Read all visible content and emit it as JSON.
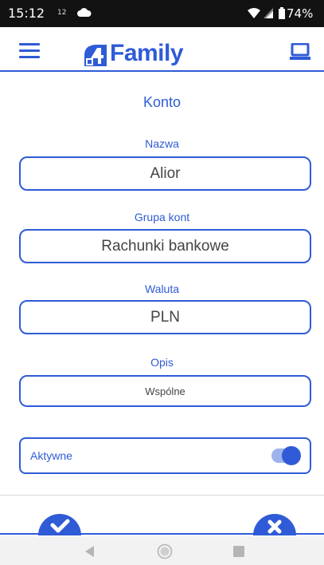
{
  "status_bar": {
    "time": "15:12",
    "notification": "12",
    "battery_percent": "74%"
  },
  "app": {
    "brand": "Family",
    "accent_color": "#2f5bd6"
  },
  "form": {
    "title": "Konto",
    "name_label": "Nazwa",
    "name_value": "Alior",
    "group_label": "Grupa kont",
    "group_value": "Rachunki bankowe",
    "currency_label": "Waluta",
    "currency_value": "PLN",
    "description_label": "Opis",
    "description_value": "Wspólne",
    "active_label": "Aktywne",
    "active_on": true
  },
  "icons": {
    "menu": "hamburger-icon",
    "desktop": "desktop-icon",
    "confirm": "check-icon",
    "cancel": "close-icon"
  }
}
